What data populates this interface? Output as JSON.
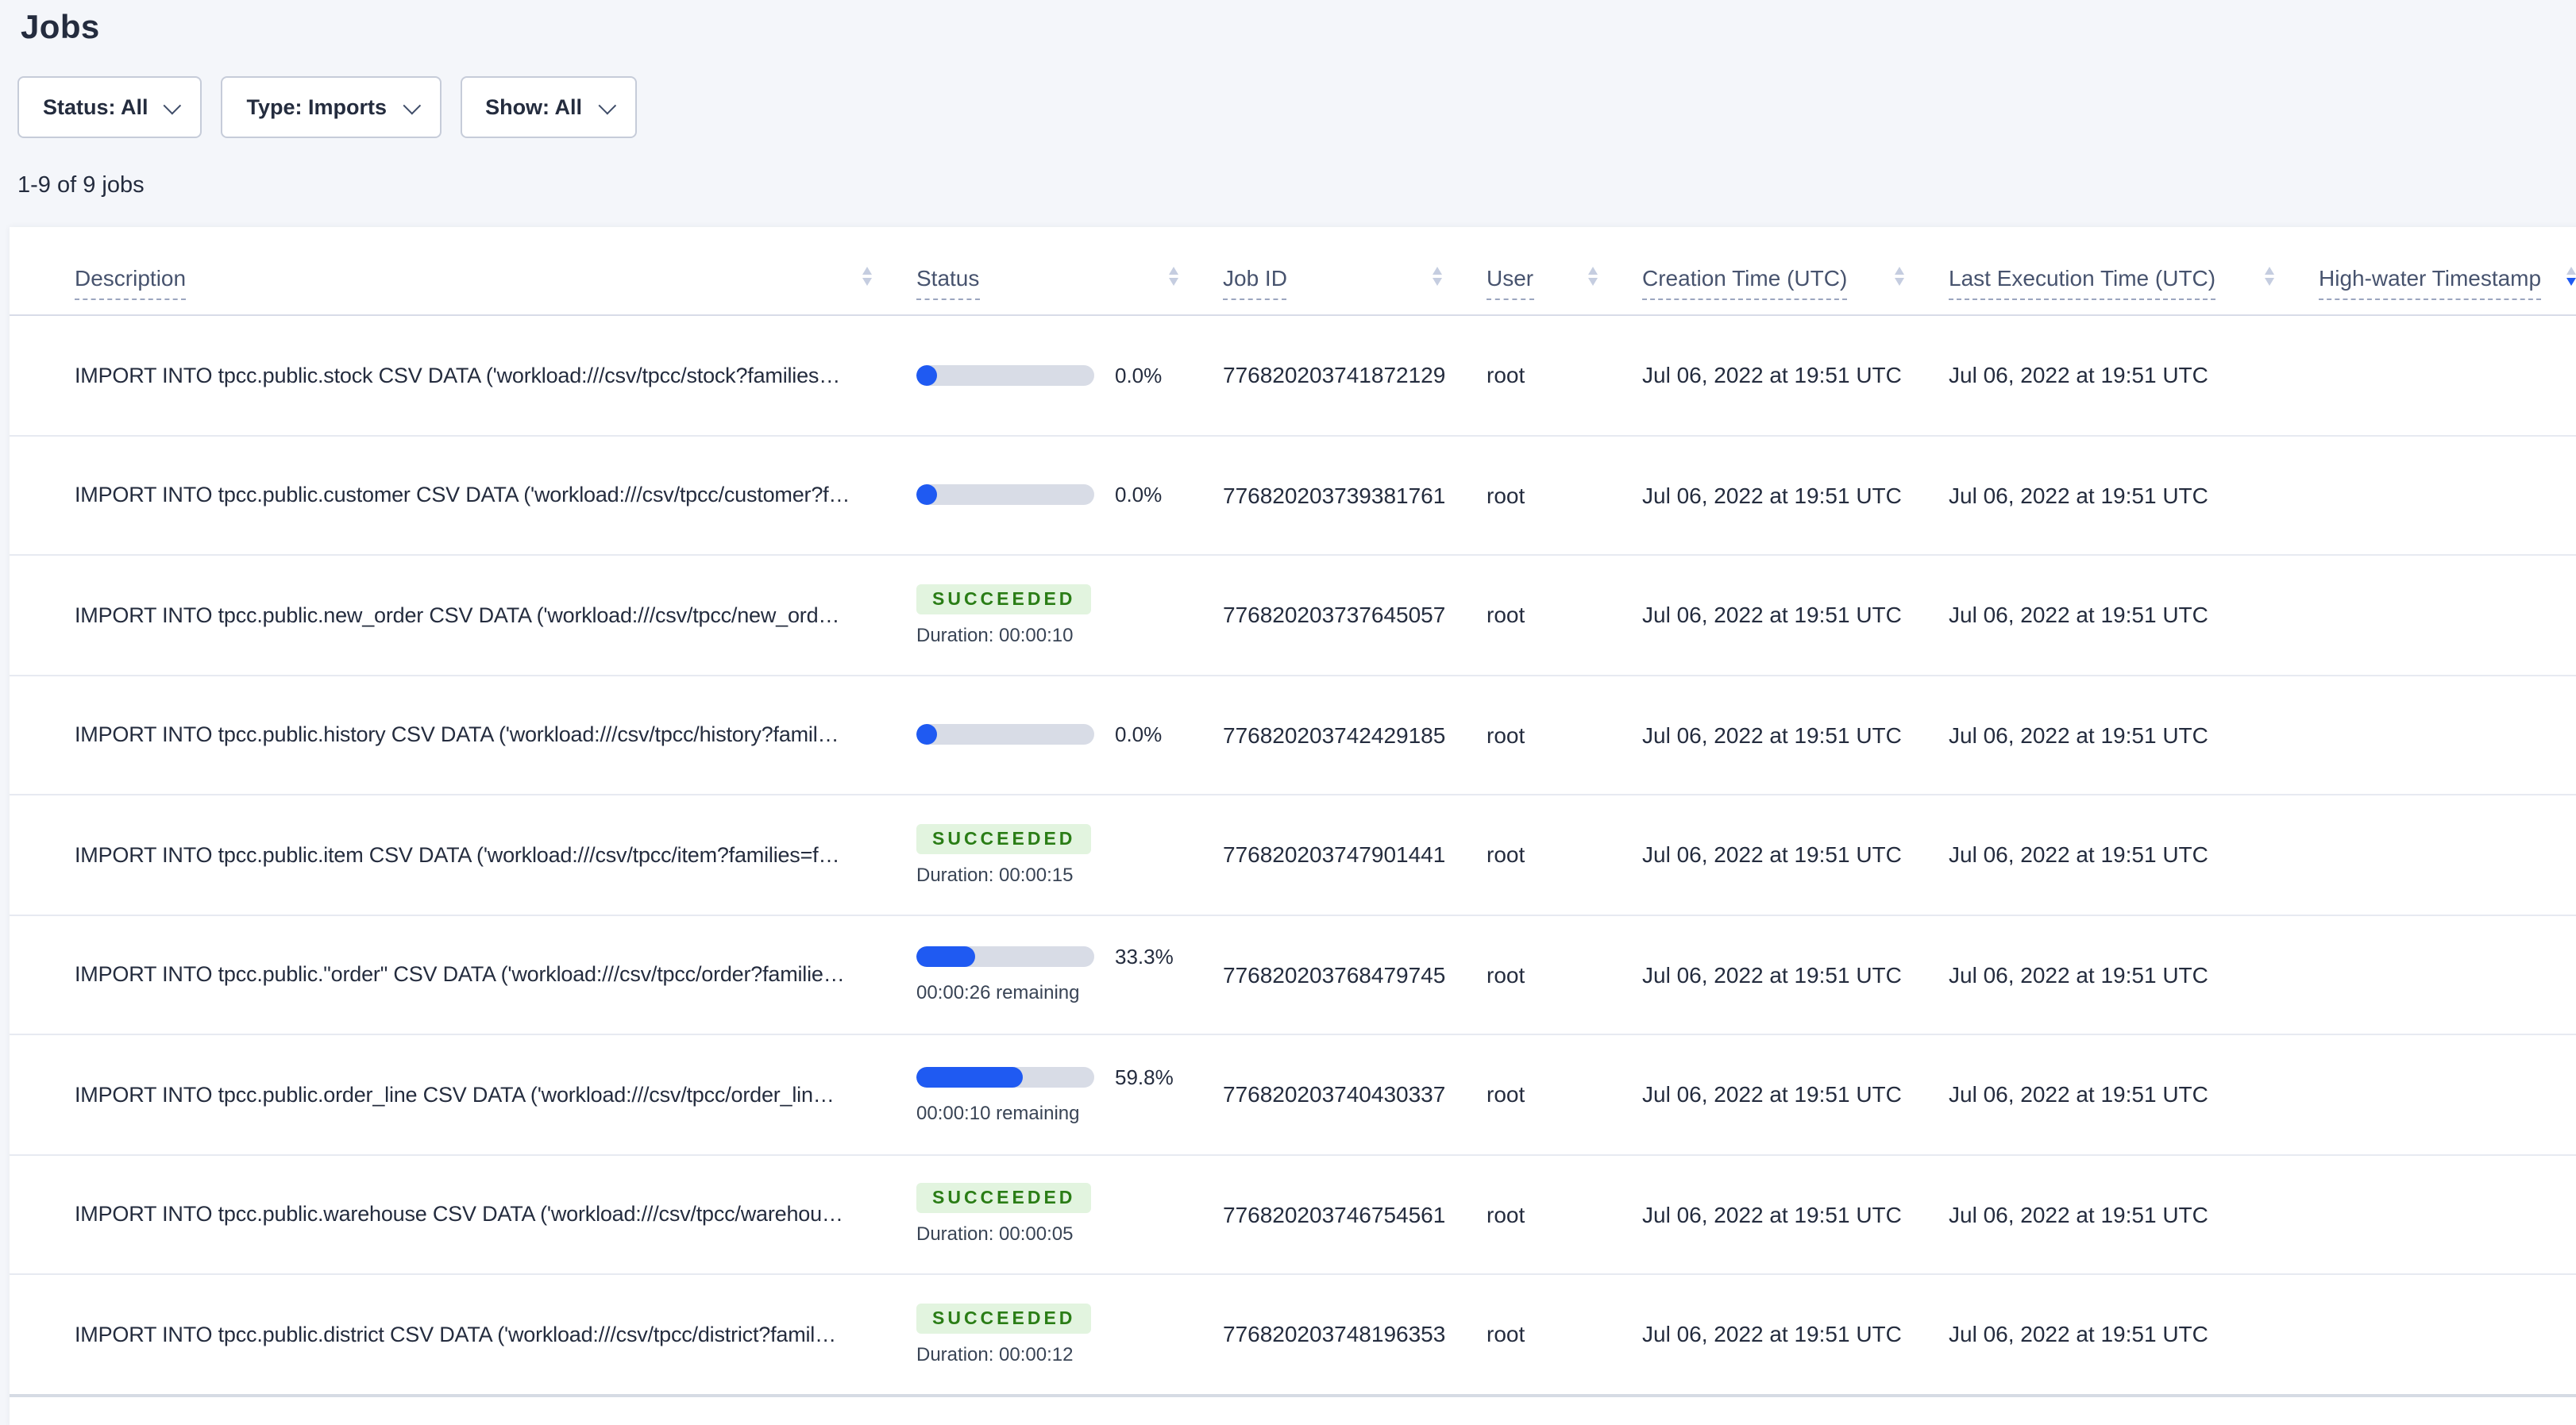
{
  "page": {
    "title": "Jobs"
  },
  "filters": [
    {
      "label": "Status: All"
    },
    {
      "label": "Type: Imports"
    },
    {
      "label": "Show: All"
    }
  ],
  "summary": "1-9 of 9 jobs",
  "colors": {
    "accent_blue": "#1f5af2",
    "progress_track": "#d8dce6",
    "succeeded_bg": "#e2f4df",
    "succeeded_text": "#2a7d16",
    "page_background": "#f4f6fa"
  },
  "table": {
    "columns": [
      {
        "label": "Description",
        "sort": "none"
      },
      {
        "label": "Status",
        "sort": "none"
      },
      {
        "label": "Job ID",
        "sort": "none"
      },
      {
        "label": "User",
        "sort": "none"
      },
      {
        "label": "Creation Time (UTC)",
        "sort": "none"
      },
      {
        "label": "Last Execution Time (UTC)",
        "sort": "none"
      },
      {
        "label": "High-water Timestamp",
        "sort": "desc"
      }
    ],
    "rows": [
      {
        "description": "IMPORT INTO tpcc.public.stock CSV DATA ('workload:///csv/tpcc/stock?families…",
        "status": {
          "kind": "progress",
          "percent_label": "0.0%",
          "percent_value": 0.0,
          "remaining": ""
        },
        "job_id": "776820203741872129",
        "user": "root",
        "creation_time": "Jul 06, 2022 at 19:51 UTC",
        "last_execution_time": "Jul 06, 2022 at 19:51 UTC",
        "high_water": ""
      },
      {
        "description": "IMPORT INTO tpcc.public.customer CSV DATA ('workload:///csv/tpcc/customer?f…",
        "status": {
          "kind": "progress",
          "percent_label": "0.0%",
          "percent_value": 0.0,
          "remaining": ""
        },
        "job_id": "776820203739381761",
        "user": "root",
        "creation_time": "Jul 06, 2022 at 19:51 UTC",
        "last_execution_time": "Jul 06, 2022 at 19:51 UTC",
        "high_water": ""
      },
      {
        "description": "IMPORT INTO tpcc.public.new_order CSV DATA ('workload:///csv/tpcc/new_ord…",
        "status": {
          "kind": "succeeded",
          "badge": "SUCCEEDED",
          "duration": "Duration: 00:00:10"
        },
        "job_id": "776820203737645057",
        "user": "root",
        "creation_time": "Jul 06, 2022 at 19:51 UTC",
        "last_execution_time": "Jul 06, 2022 at 19:51 UTC",
        "high_water": ""
      },
      {
        "description": "IMPORT INTO tpcc.public.history CSV DATA ('workload:///csv/tpcc/history?famil…",
        "status": {
          "kind": "progress",
          "percent_label": "0.0%",
          "percent_value": 0.0,
          "remaining": ""
        },
        "job_id": "776820203742429185",
        "user": "root",
        "creation_time": "Jul 06, 2022 at 19:51 UTC",
        "last_execution_time": "Jul 06, 2022 at 19:51 UTC",
        "high_water": ""
      },
      {
        "description": "IMPORT INTO tpcc.public.item CSV DATA ('workload:///csv/tpcc/item?families=f…",
        "status": {
          "kind": "succeeded",
          "badge": "SUCCEEDED",
          "duration": "Duration: 00:00:15"
        },
        "job_id": "776820203747901441",
        "user": "root",
        "creation_time": "Jul 06, 2022 at 19:51 UTC",
        "last_execution_time": "Jul 06, 2022 at 19:51 UTC",
        "high_water": ""
      },
      {
        "description": "IMPORT INTO tpcc.public.\"order\" CSV DATA ('workload:///csv/tpcc/order?familie…",
        "status": {
          "kind": "progress",
          "percent_label": "33.3%",
          "percent_value": 33.3,
          "remaining": "00:00:26 remaining"
        },
        "job_id": "776820203768479745",
        "user": "root",
        "creation_time": "Jul 06, 2022 at 19:51 UTC",
        "last_execution_time": "Jul 06, 2022 at 19:51 UTC",
        "high_water": ""
      },
      {
        "description": "IMPORT INTO tpcc.public.order_line CSV DATA ('workload:///csv/tpcc/order_lin…",
        "status": {
          "kind": "progress",
          "percent_label": "59.8%",
          "percent_value": 59.8,
          "remaining": "00:00:10 remaining"
        },
        "job_id": "776820203740430337",
        "user": "root",
        "creation_time": "Jul 06, 2022 at 19:51 UTC",
        "last_execution_time": "Jul 06, 2022 at 19:51 UTC",
        "high_water": ""
      },
      {
        "description": "IMPORT INTO tpcc.public.warehouse CSV DATA ('workload:///csv/tpcc/warehou…",
        "status": {
          "kind": "succeeded",
          "badge": "SUCCEEDED",
          "duration": "Duration: 00:00:05"
        },
        "job_id": "776820203746754561",
        "user": "root",
        "creation_time": "Jul 06, 2022 at 19:51 UTC",
        "last_execution_time": "Jul 06, 2022 at 19:51 UTC",
        "high_water": ""
      },
      {
        "description": "IMPORT INTO tpcc.public.district CSV DATA ('workload:///csv/tpcc/district?famil…",
        "status": {
          "kind": "succeeded",
          "badge": "SUCCEEDED",
          "duration": "Duration: 00:00:12"
        },
        "job_id": "776820203748196353",
        "user": "root",
        "creation_time": "Jul 06, 2022 at 19:51 UTC",
        "last_execution_time": "Jul 06, 2022 at 19:51 UTC",
        "high_water": ""
      }
    ]
  }
}
